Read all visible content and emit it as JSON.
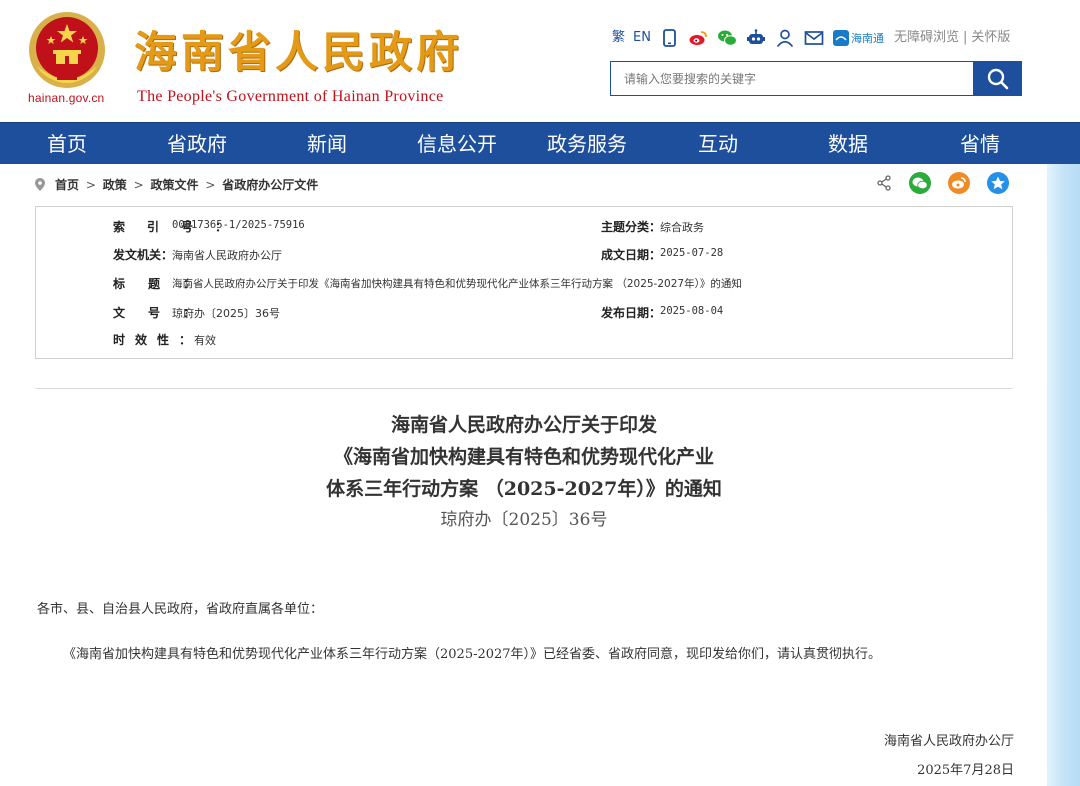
{
  "header": {
    "domain": "hainan.gov.cn",
    "title": "海南省人民政府",
    "subtitle": "The People's Government  of Hainan Province",
    "top_links": {
      "traditional": "繁",
      "english": "EN",
      "hainantong": "海南通",
      "accessible": "无障碍浏览",
      "divider": "|",
      "elder": "关怀版"
    },
    "icons": [
      "tablet-icon",
      "weibo-icon",
      "wechat-icon",
      "robot-icon",
      "user-icon",
      "mail-icon",
      "hainantong-icon"
    ],
    "search": {
      "placeholder": "请输入您要搜索的关键字",
      "value": ""
    }
  },
  "nav": {
    "items": [
      "首页",
      "省政府",
      "新闻",
      "信息公开",
      "政务服务",
      "互动",
      "数据",
      "省情"
    ]
  },
  "breadcrumb": {
    "items": [
      "首页",
      "政策",
      "政策文件",
      "省政府办公厅文件"
    ],
    "separator": ">"
  },
  "share_icons": [
    "share-icon",
    "wechat-icon",
    "weibo-icon",
    "qzone-icon"
  ],
  "meta": {
    "index_label": "索引号",
    "index_value": "00817365-1/2025-75916",
    "category_label": "主题分类",
    "category_value": "综合政务",
    "issuer_label": "发文机关",
    "issuer_value": "海南省人民政府办公厅",
    "created_label": "成文日期",
    "created_value": "2025-07-28",
    "title_label": "标题",
    "title_value": "海南省人民政府办公厅关于印发《海南省加快构建具有特色和优势现代化产业体系三年行动方案 （2025-2027年）》的通知",
    "docno_label": "文号",
    "docno_value": "琼府办〔2025〕36号",
    "published_label": "发布日期",
    "published_value": "2025-08-04",
    "validity_label": "时效性",
    "validity_value": "有效"
  },
  "document": {
    "title_line1": "海南省人民政府办公厅关于印发",
    "title_line2": "《海南省加快构建具有特色和优势现代化产业",
    "title_line3": "体系三年行动方案 （2025-2027年）》的通知",
    "number": "琼府办〔2025〕36号",
    "salutation": "各市、县、自治县人民政府，省政府直属各单位：",
    "body": "《海南省加快构建具有特色和优势现代化产业体系三年行动方案（2025-2027年）》已经省委、省政府同意，现印发给你们，请认真贯彻执行。",
    "signer": "海南省人民政府办公厅",
    "date": "2025年7月28日"
  },
  "colors": {
    "nav_bg": "#1d4f9c",
    "title_gold": "#e39a17",
    "emblem_red": "#c0101a",
    "link_blue": "#1d4f9c"
  }
}
